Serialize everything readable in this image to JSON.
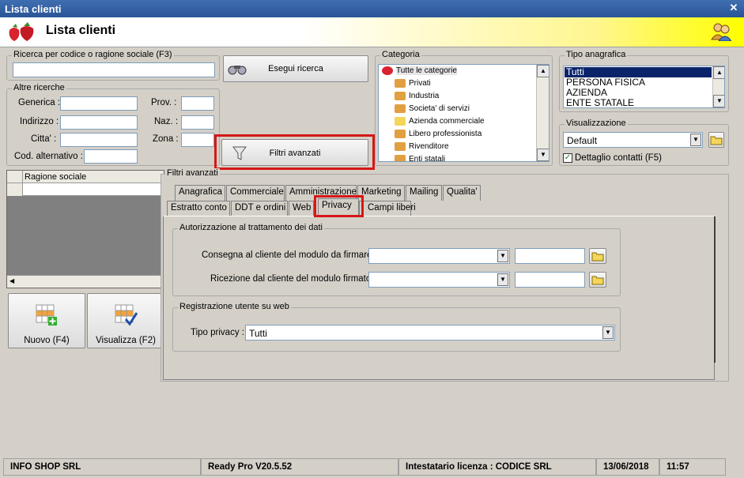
{
  "window": {
    "title": "Lista clienti"
  },
  "header": {
    "title": "Lista clienti"
  },
  "search": {
    "group_label": "Ricerca per codice o ragione sociale (F3)",
    "value": "",
    "button": "Esegui ricerca"
  },
  "other_search": {
    "group_label": "Altre ricerche",
    "generica": "Generica :",
    "indirizzo": "Indirizzo :",
    "citta": "Citta' :",
    "cod_alt": "Cod. alternativo :",
    "prov": "Prov. :",
    "naz": "Naz. :",
    "zona": "Zona :"
  },
  "advanced_button": "Filtri avanzati",
  "categoria": {
    "label": "Categoria",
    "items": [
      "Tutte le categorie",
      "Privati",
      "Industria",
      "Societa' di servizi",
      "Azienda commerciale",
      "Libero professionista",
      "Rivenditore",
      "Enti statali"
    ]
  },
  "tipo_anagrafica": {
    "label": "Tipo anagrafica",
    "items": [
      "Tutti",
      "PERSONA FISICA",
      "AZIENDA",
      "ENTE STATALE"
    ],
    "selected": "Tutti"
  },
  "visualizzazione": {
    "label": "Visualizzazione",
    "value": "Default",
    "checkbox": "Dettaglio contatti (F5)"
  },
  "grid": {
    "column": "Ragione sociale"
  },
  "buttons": {
    "nuovo": "Nuovo (F4)",
    "visualizza": "Visualizza (F2)"
  },
  "filtri_avanzati": {
    "label": "Filtri avanzati",
    "tabs_row1": [
      "Anagrafica",
      "Commerciale",
      "Amministrazione",
      "Marketing",
      "Mailing",
      "Qualita'"
    ],
    "tabs_row2": [
      "Estratto conto",
      "DDT e ordini",
      "Web",
      "Privacy",
      "Campi liberi"
    ],
    "active_tab": "Privacy",
    "privacy_group": "Autorizzazione al trattamento dei dati",
    "consegna": "Consegna al cliente del modulo da firmare :",
    "ricezione": "Ricezione dal cliente del modulo firmato :",
    "web_group": "Registrazione utente su web",
    "tipo_privacy_label": "Tipo privacy :",
    "tipo_privacy_value": "Tutti"
  },
  "statusbar": {
    "company": "INFO SHOP SRL",
    "version": "Ready Pro V20.5.52",
    "license": "Intestatario licenza : CODICE SRL",
    "date": "13/06/2018",
    "time": "11:57"
  },
  "colors": {
    "titlebar": "#2a5597",
    "highlight": "#d61717",
    "selection": "#0a246a"
  }
}
